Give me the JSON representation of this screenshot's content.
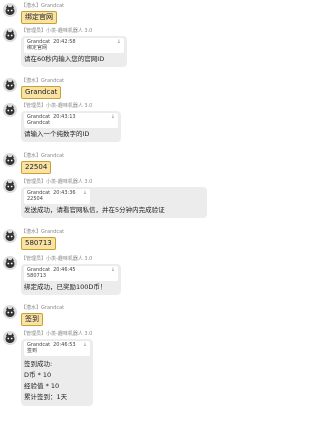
{
  "messages": [
    {
      "kind": "user",
      "meta_tag": "【潜水】",
      "meta_name": "Grandcat",
      "text": "绑定官网"
    },
    {
      "kind": "bot",
      "meta_tag": "【管理员】",
      "meta_name": "小羡-趣味机器人 3.0",
      "quote_name": "Grandcat",
      "quote_time": "20:42:58",
      "quote_text": "绑定官网",
      "lines": [
        "请在60秒内输入您的官网ID"
      ]
    },
    {
      "kind": "user",
      "meta_tag": "【潜水】",
      "meta_name": "Grandcat",
      "text": "Grandcat"
    },
    {
      "kind": "bot",
      "meta_tag": "【管理员】",
      "meta_name": "小羡-趣味机器人 3.0",
      "quote_name": "Grandcat",
      "quote_time": "20:43:13",
      "quote_text": "Grandcat",
      "lines": [
        "请输入一个纯数字的ID"
      ]
    },
    {
      "kind": "user",
      "meta_tag": "【潜水】",
      "meta_name": "Grandcat",
      "text": "22504"
    },
    {
      "kind": "bot",
      "meta_tag": "【管理员】",
      "meta_name": "小羡-趣味机器人 3.0",
      "quote_name": "Grandcat",
      "quote_time": "20:43:36",
      "quote_text": "22504",
      "lines": [
        "发送成功，请看官网私信，并在5分钟内完成验证"
      ]
    },
    {
      "kind": "user",
      "meta_tag": "【潜水】",
      "meta_name": "Grandcat",
      "text": "580713"
    },
    {
      "kind": "bot",
      "meta_tag": "【管理员】",
      "meta_name": "小羡-趣味机器人 3.0",
      "quote_name": "Grandcat",
      "quote_time": "20:46:45",
      "quote_text": "580713",
      "lines": [
        "绑定成功，已奖励100D币！"
      ]
    },
    {
      "kind": "user",
      "meta_tag": "【潜水】",
      "meta_name": "Grandcat",
      "text": "签到"
    },
    {
      "kind": "bot",
      "meta_tag": "【管理员】",
      "meta_name": "小羡-趣味机器人 3.0",
      "quote_name": "Grandcat",
      "quote_time": "20:46:53",
      "quote_text": "签到",
      "lines": [
        "签到成功:",
        "D币 * 10",
        "经验值 * 10",
        "累计签到：1天"
      ]
    }
  ],
  "icons": {
    "pin": "pin-icon",
    "avatar": "cat-avatar-icon"
  },
  "colors": {
    "user_bubble": "#f9e3a4",
    "user_border": "#c9a12e",
    "bot_bubble": "#ececec"
  }
}
